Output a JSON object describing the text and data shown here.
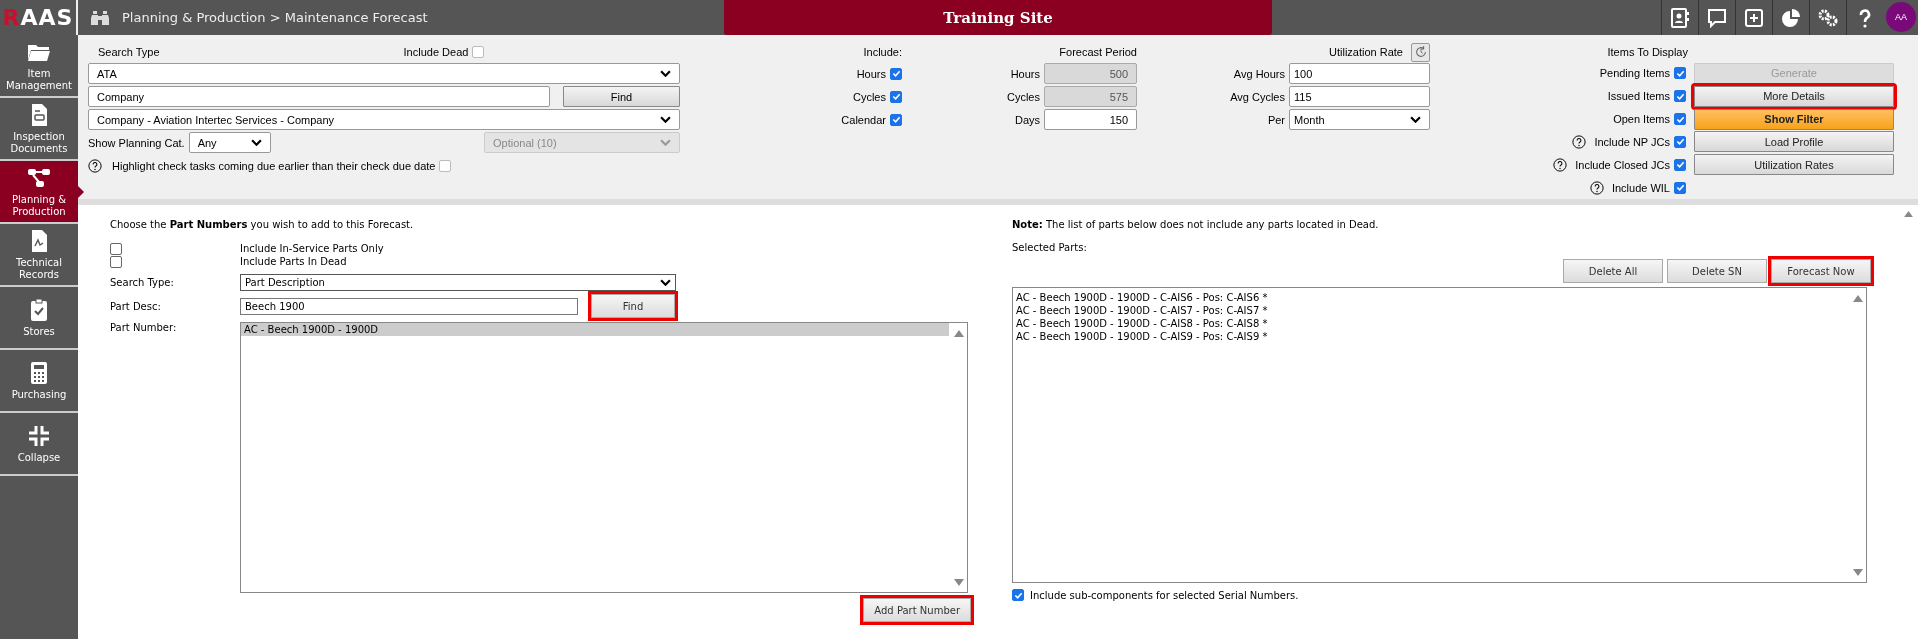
{
  "logo": {
    "accent": "R",
    "rest": "AAS"
  },
  "breadcrumb": "Planning & Production > Maintenance Forecast",
  "site_banner": "Training Site",
  "user_avatar": "AA",
  "sidebar": {
    "items": [
      {
        "label": "Item Management",
        "selected": false
      },
      {
        "label": "Inspection Documents",
        "selected": false
      },
      {
        "label": "Planning & Production",
        "selected": true
      },
      {
        "label": "Technical Records",
        "selected": false
      },
      {
        "label": "Stores",
        "selected": false
      },
      {
        "label": "Purchasing",
        "selected": false
      },
      {
        "label": "Collapse",
        "selected": false
      }
    ]
  },
  "search": {
    "type_label": "Search Type",
    "include_dead": {
      "label": "Include Dead",
      "checked": false
    },
    "type_value": "ATA",
    "company_value": "Company",
    "find_button": "Find",
    "company_select": "Company - Aviation Intertec Services - Company",
    "planning_cat_label": "Show Planning Cat.",
    "planning_cat_value": "Any",
    "optional_value": "Optional (10)",
    "highlight": {
      "label": "Highlight check tasks coming due earlier than their check due date",
      "checked": false
    }
  },
  "include": {
    "title": "Include:",
    "options": [
      {
        "label": "Hours",
        "checked": true
      },
      {
        "label": "Cycles",
        "checked": true
      },
      {
        "label": "Calendar",
        "checked": true
      }
    ]
  },
  "forecast_period": {
    "title": "Forecast Period",
    "fields": [
      {
        "label": "Hours",
        "value": "500",
        "disabled": true
      },
      {
        "label": "Cycles",
        "value": "575",
        "disabled": true
      },
      {
        "label": "Days",
        "value": "150",
        "disabled": false
      }
    ]
  },
  "utilization": {
    "title": "Utilization Rate",
    "fields": [
      {
        "label": "Avg Hours",
        "value": "100"
      },
      {
        "label": "Avg Cycles",
        "value": "115"
      }
    ],
    "per_label": "Per",
    "per_value": "Month"
  },
  "items_to_display": {
    "title": "Items To Display",
    "options": [
      {
        "label": "Pending Items",
        "checked": true,
        "help": false
      },
      {
        "label": "Issued Items",
        "checked": true,
        "help": false
      },
      {
        "label": "Open Items",
        "checked": true,
        "help": false
      },
      {
        "label": "Include NP JCs",
        "checked": true,
        "help": true
      },
      {
        "label": "Include Closed JCs",
        "checked": true,
        "help": true
      },
      {
        "label": "Include WIL",
        "checked": true,
        "help": true
      }
    ],
    "buttons": [
      {
        "label": "Generate",
        "kind": "disabled",
        "highlighted": false
      },
      {
        "label": "More Details",
        "kind": "default",
        "highlighted": true
      },
      {
        "label": "Show Filter",
        "kind": "primary",
        "highlighted": false
      },
      {
        "label": "Load Profile",
        "kind": "default",
        "highlighted": false
      },
      {
        "label": "Utilization Rates",
        "kind": "default",
        "highlighted": false
      }
    ]
  },
  "part_search": {
    "intro": "Choose the **Part Numbers** you wish to add to this Forecast.",
    "checkboxes": [
      {
        "label": "Include In-Service Parts Only",
        "checked": false
      },
      {
        "label": "Include Parts In Dead",
        "checked": false
      }
    ],
    "search_type_label": "Search Type:",
    "search_type_value": "Part Description",
    "part_desc_label": "Part Desc:",
    "part_desc_value": "Beech 1900",
    "find_button": {
      "label": "Find",
      "highlighted": true
    },
    "part_number_label": "Part Number:",
    "part_numbers": [
      {
        "text": "AC - Beech 1900D - 1900D",
        "selected": true
      }
    ],
    "add_button": {
      "label": "Add Part Number",
      "highlighted": true
    }
  },
  "selected_parts": {
    "note": "**Note:** The list of parts below does not include any parts located in Dead.",
    "label": "Selected Parts:",
    "buttons": [
      {
        "label": "Delete All",
        "highlighted": false
      },
      {
        "label": "Delete SN",
        "highlighted": false
      },
      {
        "label": "Forecast Now",
        "highlighted": true
      }
    ],
    "items": [
      "AC - Beech 1900D - 1900D - C-AIS6 - Pos: C-AIS6 *",
      "AC - Beech 1900D - 1900D - C-AIS7 - Pos: C-AIS7 *",
      "AC - Beech 1900D - 1900D - C-AIS8 - Pos: C-AIS8 *",
      "AC - Beech 1900D - 1900D - C-AIS9 - Pos: C-AIS9 *"
    ],
    "include_sub": {
      "label": "Include sub-components for selected Serial Numbers.",
      "checked": true
    }
  }
}
